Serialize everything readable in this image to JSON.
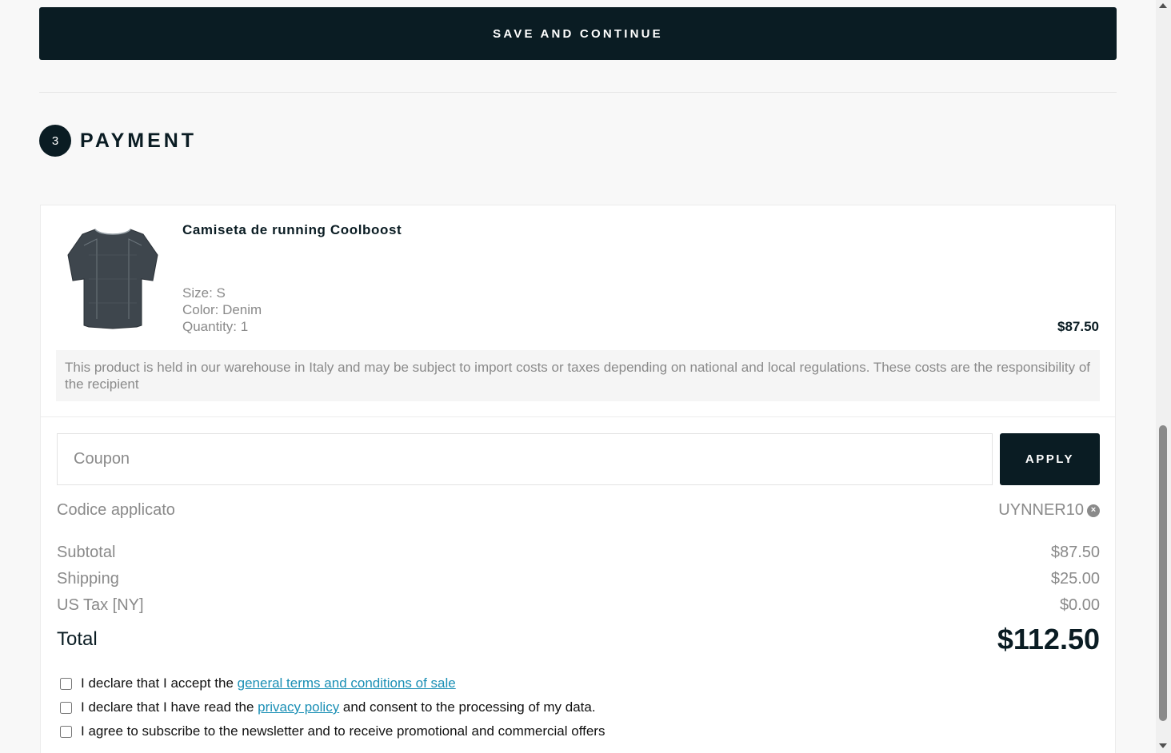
{
  "save_button": "SAVE AND CONTINUE",
  "payment": {
    "step_number": "3",
    "title": "PAYMENT"
  },
  "product": {
    "name": "Camiseta de running Coolboost",
    "size": "Size: S",
    "color": "Color: Denim",
    "quantity": "Quantity: 1",
    "price": "$87.50",
    "image_icon": "tshirt-image",
    "note": "This product is held in our warehouse in Italy and may be subject to import costs or taxes depending on national and local regulations. These costs are the responsibility of the recipient"
  },
  "coupon": {
    "placeholder": "Coupon",
    "value": "",
    "apply_label": "APPLY"
  },
  "applied_code": {
    "label": "Codice applicato",
    "code": "UYNNER10",
    "remove_icon": "close-circle-icon"
  },
  "summary": {
    "subtotal_label": "Subtotal",
    "subtotal": "$87.50",
    "shipping_label": "Shipping",
    "shipping": "$25.00",
    "tax_label": "US Tax [NY]",
    "tax": "$0.00",
    "total_label": "Total",
    "total": "$112.50"
  },
  "consents": {
    "terms_prefix": "I declare that I accept the ",
    "terms_link": "general terms and conditions of sale",
    "privacy_prefix": "I declare that I have read the ",
    "privacy_link": "privacy policy",
    "privacy_suffix": " and consent to the processing of my data.",
    "newsletter": "I agree to subscribe to the newsletter and to receive promotional and commercial offers"
  },
  "colors": {
    "primary": "#0a1c23",
    "link": "#1a8fb5",
    "muted": "#8a8a8a",
    "background": "#f8f8f8"
  }
}
